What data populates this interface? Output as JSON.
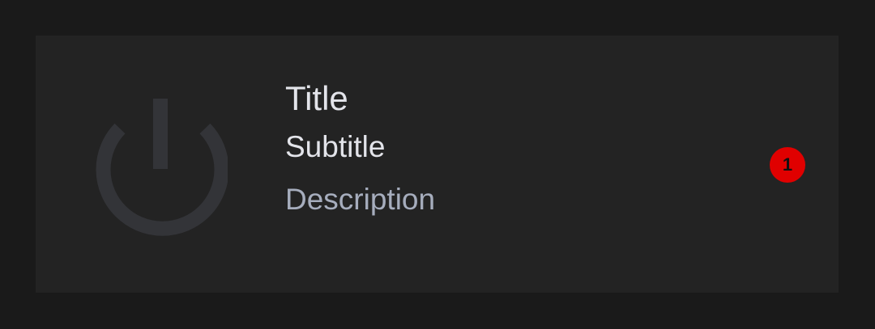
{
  "card": {
    "icon": "power-icon",
    "title": "Title",
    "subtitle": "Subtitle",
    "description": "Description",
    "badge_count": "1"
  },
  "colors": {
    "background": "#1a1a1a",
    "card": "#232323",
    "icon": "#333438",
    "primary_text": "#e3e4ea",
    "secondary_text": "#a6adbd",
    "badge": "#e00000"
  }
}
